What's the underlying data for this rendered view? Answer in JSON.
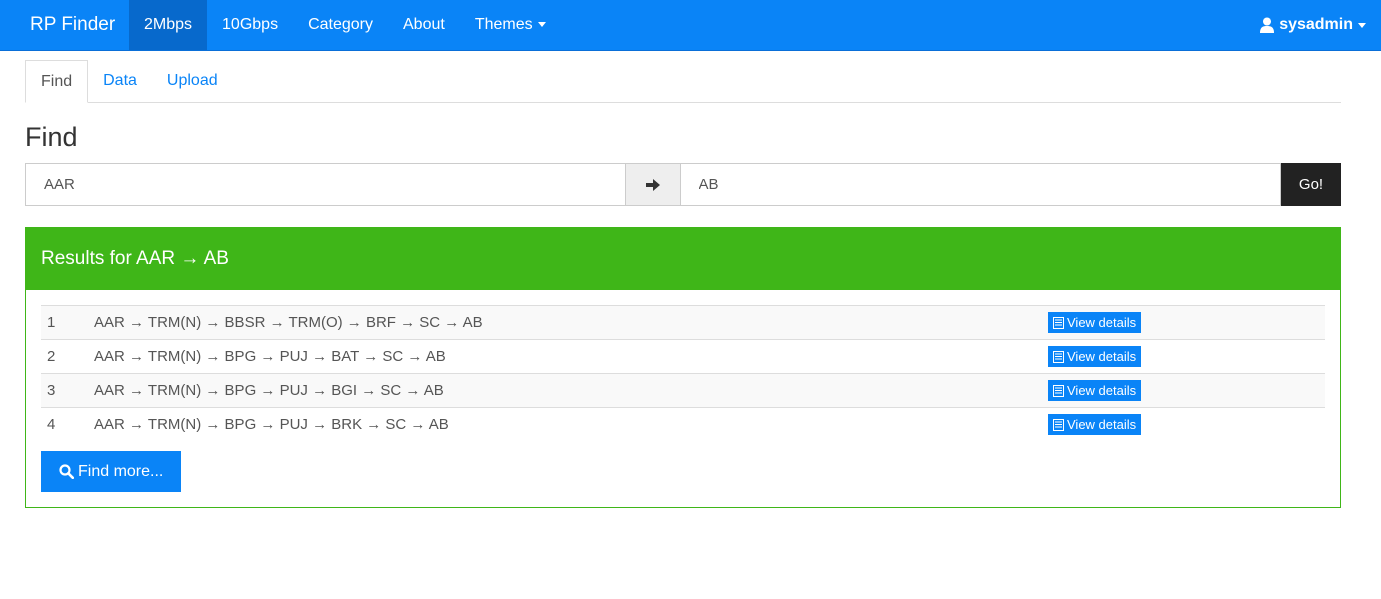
{
  "navbar": {
    "brand": "RP Finder",
    "links": [
      {
        "label": "2Mbps"
      },
      {
        "label": "10Gbps"
      },
      {
        "label": "Category"
      },
      {
        "label": "About"
      },
      {
        "label": "Themes"
      }
    ],
    "user": "sysadmin",
    "color": "#0a84f7"
  },
  "tabs": [
    {
      "label": "Find"
    },
    {
      "label": "Data"
    },
    {
      "label": "Upload"
    }
  ],
  "page_title": "Find",
  "search": {
    "from_value": "AAR",
    "to_value": "AB",
    "arrow_icon": "arrow-right-icon",
    "go_label": "Go!"
  },
  "results": {
    "heading": "Results for AAR → AB",
    "color": "#3fb618",
    "rows": [
      {
        "num": "1",
        "route": "AAR → TRM(N) → BBSR → TRM(O) → BRF → SC → AB",
        "action": "View details"
      },
      {
        "num": "2",
        "route": "AAR → TRM(N) → BPG → PUJ → BAT → SC → AB",
        "action": "View details"
      },
      {
        "num": "3",
        "route": "AAR → TRM(N) → BPG → PUJ → BGI → SC → AB",
        "action": "View details"
      },
      {
        "num": "4",
        "route": "AAR → TRM(N) → BPG → PUJ → BRK → SC → AB",
        "action": "View details"
      }
    ],
    "find_more_label": "Find more..."
  }
}
